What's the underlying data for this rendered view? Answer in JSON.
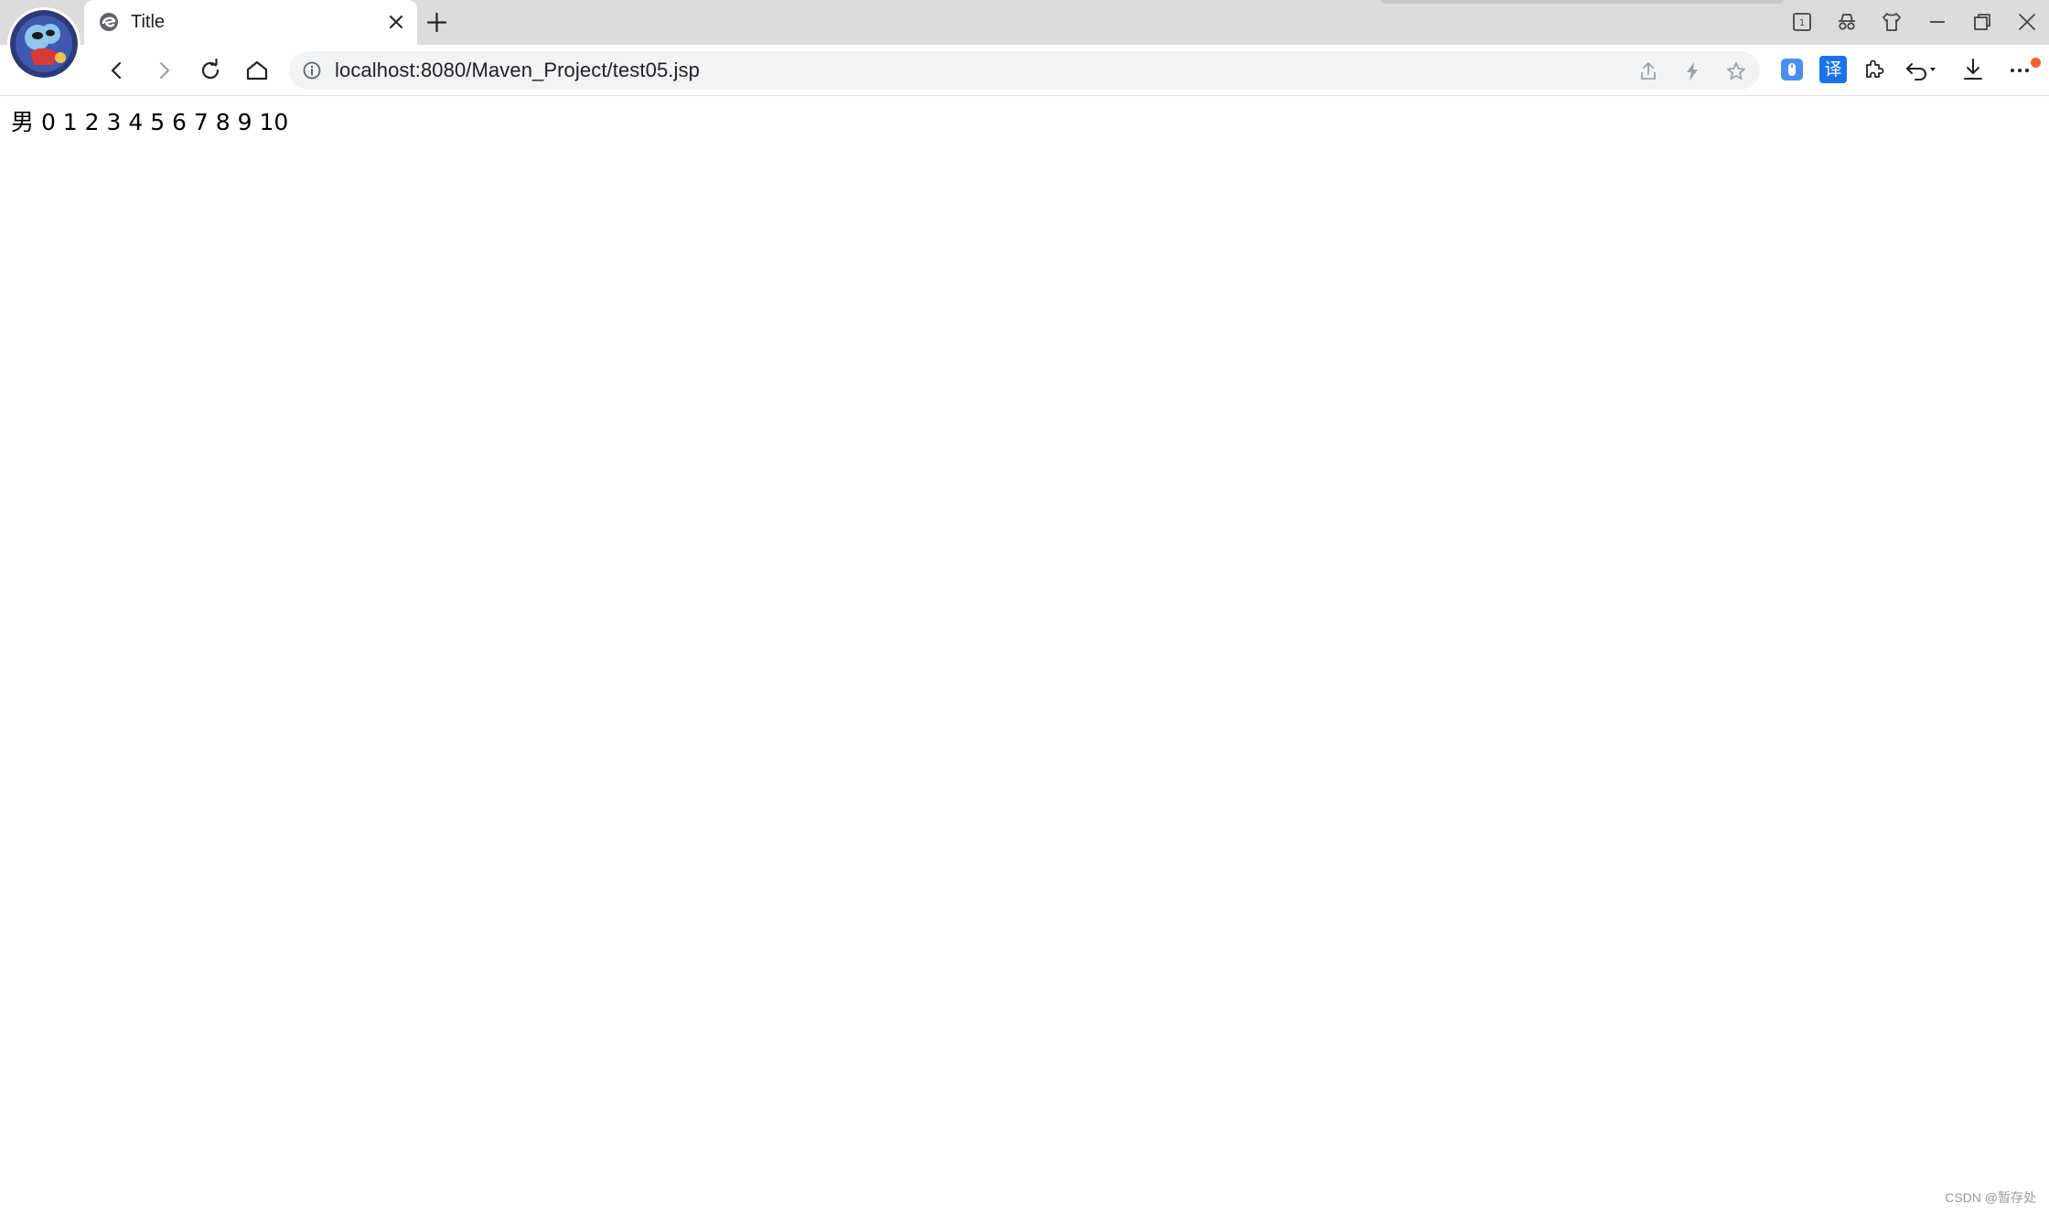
{
  "tab": {
    "title": "Title",
    "favicon": "edge-e-icon"
  },
  "toolbar": {
    "url": "localhost:8080/Maven_Project/test05.jsp",
    "translate_label": "译"
  },
  "page": {
    "output": "男 0 1 2 3 4 5 6 7 8 9 10"
  },
  "watermark": "CSDN @暂存处",
  "colors": {
    "tabstrip": "#dcdcdc",
    "omnibox": "#f1f3f4",
    "accent_blue": "#1a73e8",
    "notification": "#f0602a"
  }
}
